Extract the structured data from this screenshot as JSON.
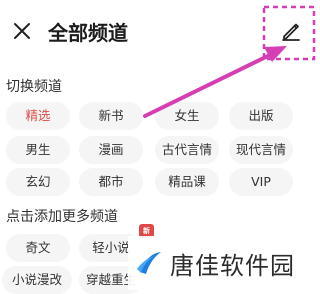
{
  "header": {
    "title": "全部频道",
    "close_icon": "close-icon",
    "edit_icon": "pencil-icon"
  },
  "switch_section": {
    "title": "切换频道",
    "chips": [
      {
        "label": "精选",
        "selected": true
      },
      {
        "label": "新书",
        "selected": false
      },
      {
        "label": "女生",
        "selected": false
      },
      {
        "label": "出版",
        "selected": false
      },
      {
        "label": "男生",
        "selected": false
      },
      {
        "label": "漫画",
        "selected": false
      },
      {
        "label": "古代言情",
        "selected": false
      },
      {
        "label": "现代言情",
        "selected": false
      },
      {
        "label": "玄幻",
        "selected": false
      },
      {
        "label": "都市",
        "selected": false
      },
      {
        "label": "精品课",
        "selected": false
      },
      {
        "label": "VIP",
        "selected": false
      }
    ]
  },
  "add_section": {
    "title": "点击添加更多频道",
    "chips": [
      {
        "label": "奇文"
      },
      {
        "label": "轻小说"
      },
      {
        "label": "小说漫改"
      },
      {
        "label": "穿越重生"
      }
    ],
    "new_badge": "新"
  },
  "watermark": {
    "text": "唐佳软件园",
    "icon": "logo-swoosh-icon"
  },
  "colors": {
    "selected_chip_text": "#e0504a",
    "chip_bg": "#f5f5f5",
    "annotation_arrow": "#d63fb4",
    "badge": "#e04848",
    "logo_blue": "#1e7fe0"
  }
}
